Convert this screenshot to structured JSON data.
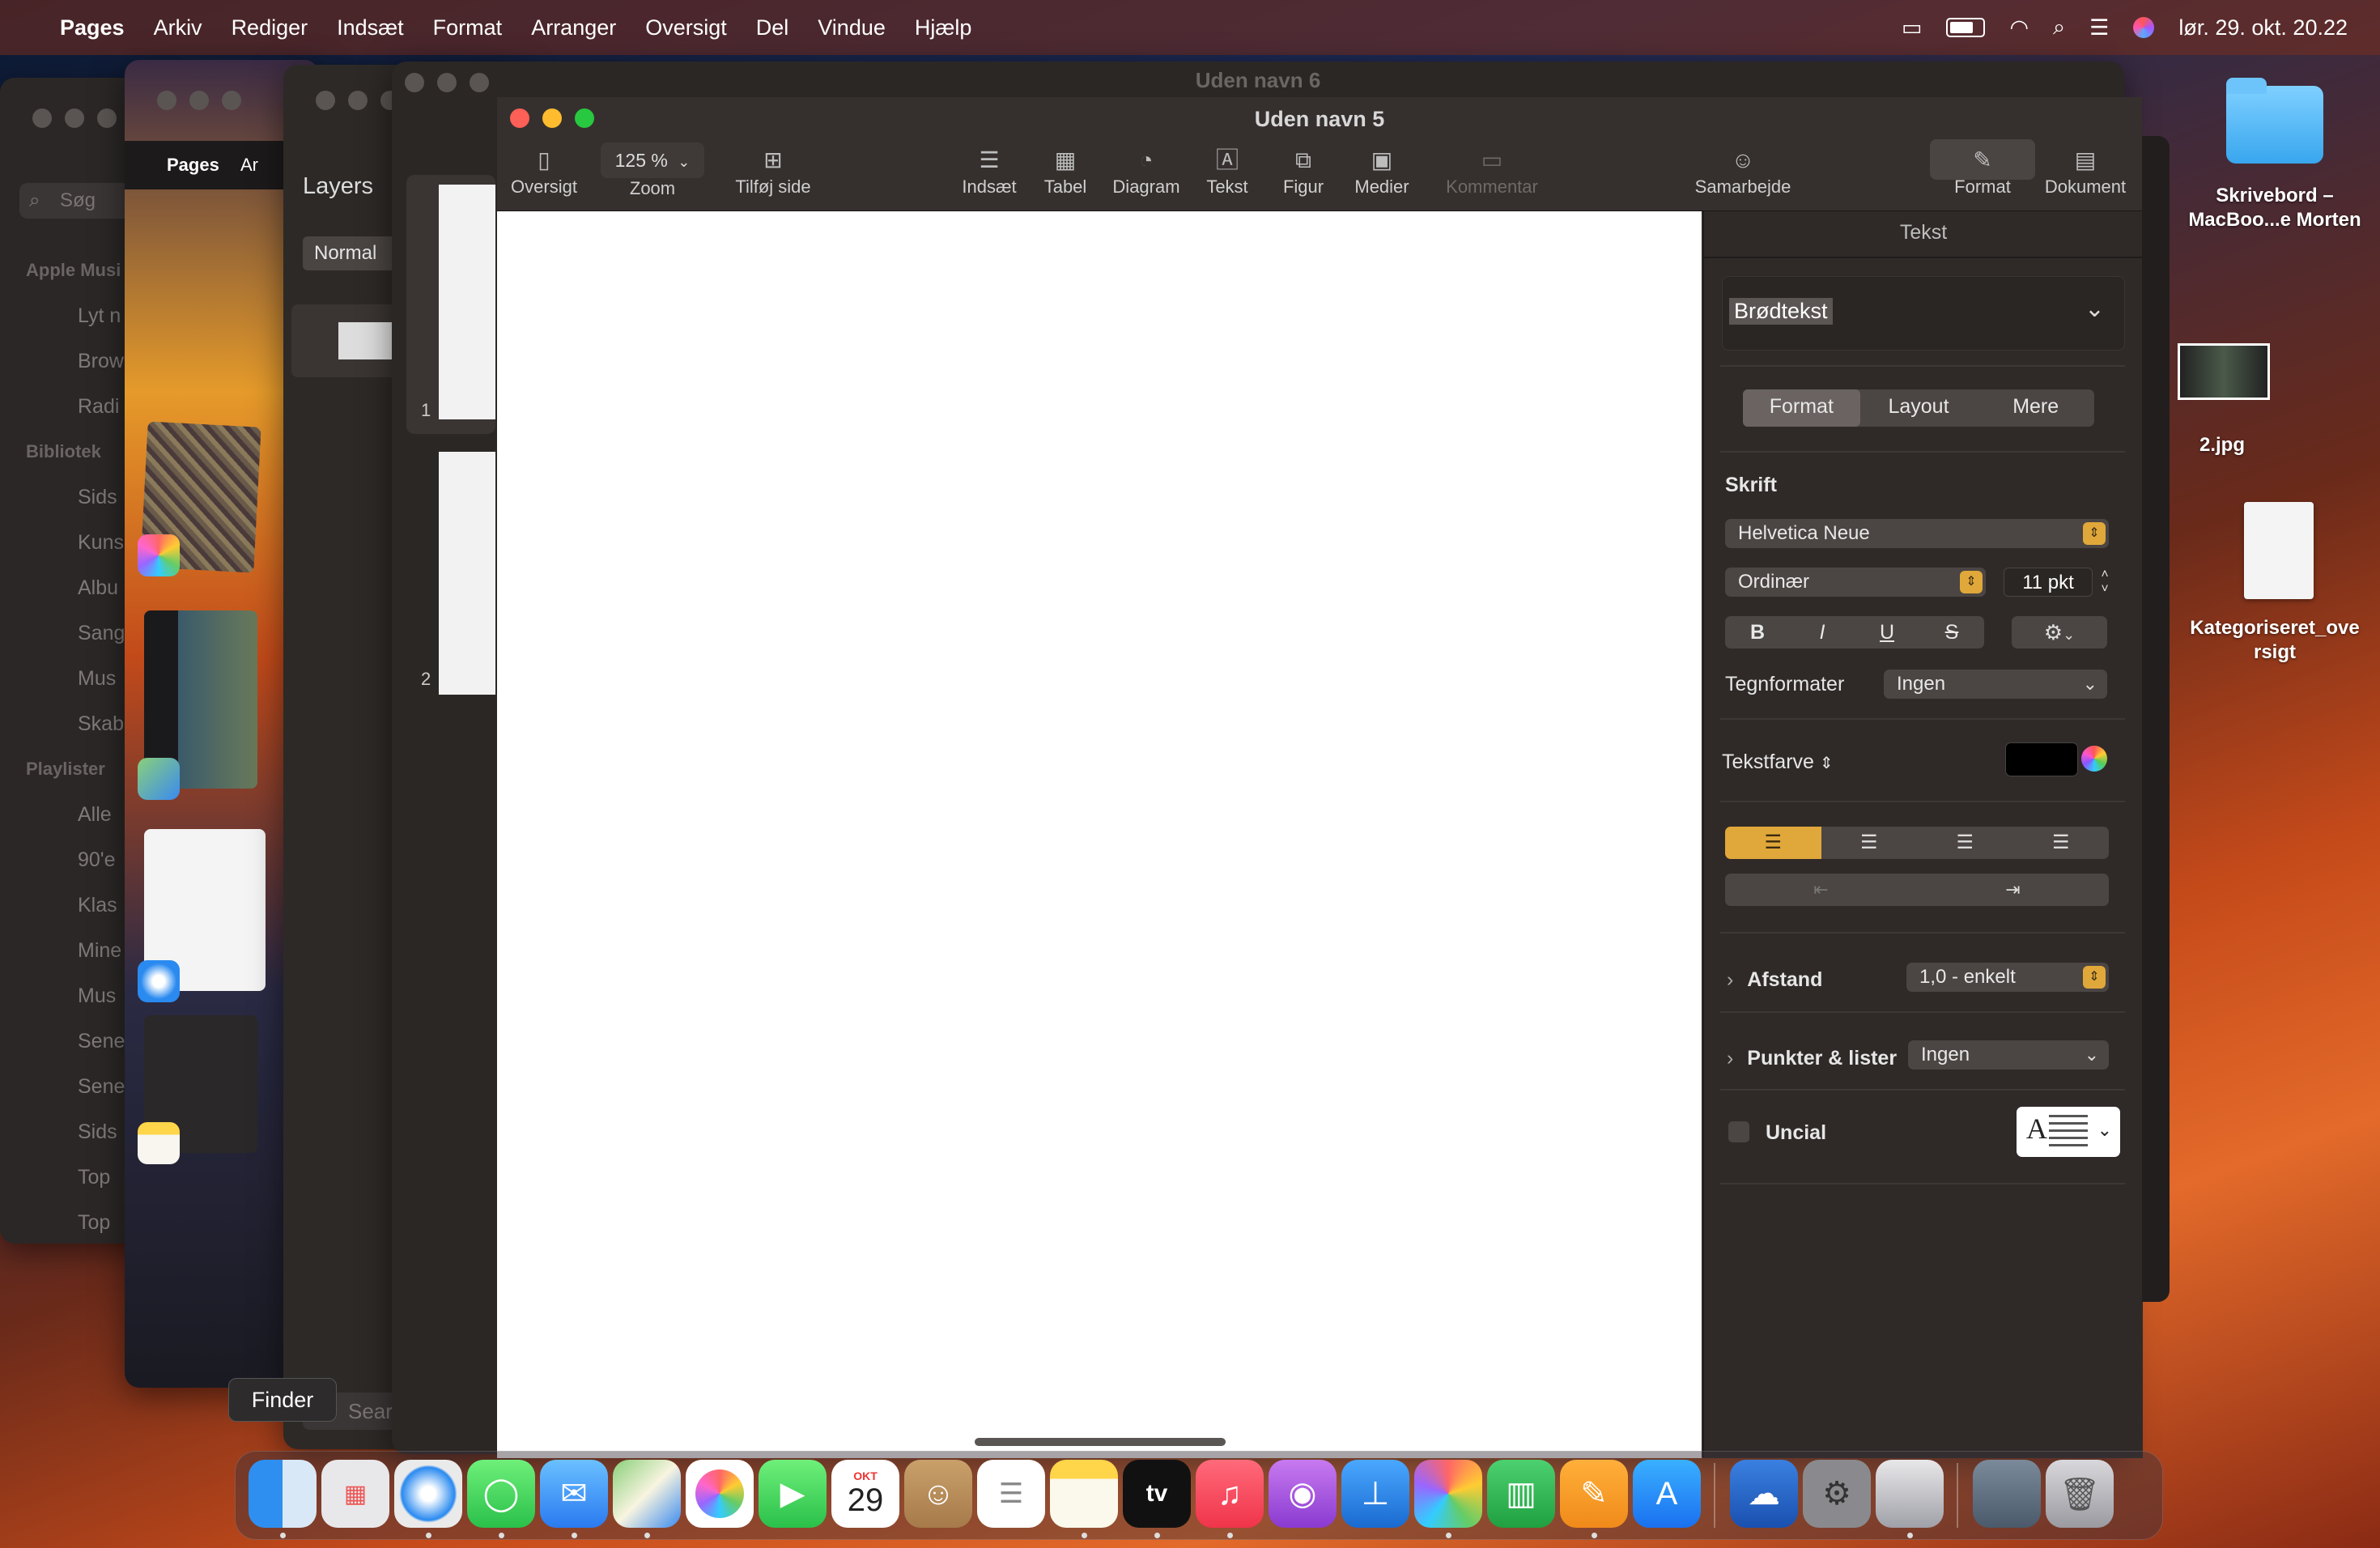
{
  "menubar": {
    "app": "Pages",
    "items": [
      "Arkiv",
      "Rediger",
      "Indsæt",
      "Format",
      "Arranger",
      "Oversigt",
      "Del",
      "Vindue",
      "Hjælp"
    ],
    "clock": "lør. 29. okt. 20.22"
  },
  "bg_windows": {
    "music_search": "Søg",
    "music_sections": [
      "Apple Musi",
      "Lyt n",
      "Brow",
      "Radi",
      "Bibliotek",
      "Sids",
      "Kuns",
      "Albu",
      "Sang",
      "Mus",
      "Skab",
      "Playlister",
      "Alle",
      "90'e",
      "Klas",
      "Mine",
      "Mus",
      "Sene",
      "Sene",
      "Sids",
      "Top",
      "Top"
    ],
    "pages_small_app": "Pages",
    "pages_small_menu": "Ar",
    "layers_title": "Layers",
    "layers_mode": "Normal",
    "search_text": "Sear",
    "win6_title": "Uden navn 6",
    "thumb_numbers": [
      "1",
      "2"
    ]
  },
  "window": {
    "title": "Uden navn 5",
    "zoom_value": "125 %",
    "toolbar": {
      "oversigt": "Oversigt",
      "zoom": "Zoom",
      "tilfoej_side": "Tilføj side",
      "indsaet": "Indsæt",
      "tabel": "Tabel",
      "diagram": "Diagram",
      "tekst": "Tekst",
      "figur": "Figur",
      "medier": "Medier",
      "kommentar": "Kommentar",
      "samarbejde": "Samarbejde",
      "format": "Format",
      "dokument": "Dokument"
    }
  },
  "panel": {
    "header": "Tekst",
    "style": "Brødtekst",
    "tabs": [
      "Format",
      "Layout",
      "Mere"
    ],
    "active_tab": "Format",
    "font_section": "Skrift",
    "font_family": "Helvetica Neue",
    "font_weight": "Ordinær",
    "font_size": "11 pkt",
    "style_buttons": [
      "B",
      "I",
      "U",
      "S"
    ],
    "char_styles_label": "Tegnformater",
    "char_styles_value": "Ingen",
    "text_color_label": "Tekstfarve",
    "text_color": "#000000",
    "spacing_label": "Afstand",
    "spacing_value": "1,0 - enkelt",
    "bullets_label": "Punkter & lister",
    "bullets_value": "Ingen",
    "dropcap_label": "Uncial",
    "accent": "#e0a83a"
  },
  "desktop": {
    "folder_label_1": "Skrivebord –",
    "folder_label_2": "MacBoo...e Morten",
    "image_label": "2.jpg",
    "doc_label_1": "Kategoriseret_ove",
    "doc_label_2": "rsigt"
  },
  "dock": {
    "tooltip": "Finder",
    "calendar_month": "OKT",
    "calendar_day": "29",
    "tv_label": "tv",
    "apps": [
      "finder-icon",
      "launchpad-icon",
      "safari-icon",
      "messages-icon",
      "mail-icon",
      "maps-icon",
      "photos-icon",
      "facetime-icon",
      "calendar-icon",
      "contacts-icon",
      "reminders-icon",
      "notes-icon",
      "tv-icon",
      "music-icon",
      "podcasts-icon",
      "keynote-icon",
      "pixelmator-icon",
      "numbers-icon",
      "pages-icon",
      "appstore-icon",
      "weather-icon",
      "settings-icon",
      "preview-icon",
      "photo-stack-icon",
      "trash-icon"
    ]
  }
}
